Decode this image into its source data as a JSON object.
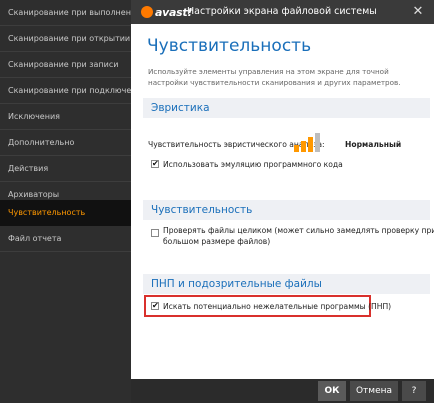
{
  "window": {
    "title": "Настройки экрана файловой системы",
    "logo_text": "avast!"
  },
  "sidebar": {
    "items": [
      {
        "label": "Сканирование при выполнении"
      },
      {
        "label": "Сканирование при открытии"
      },
      {
        "label": "Сканирование при записи"
      },
      {
        "label": "Сканирование при подключении"
      },
      {
        "label": "Исключения"
      },
      {
        "label": "Дополнительно"
      },
      {
        "label": "Действия"
      },
      {
        "label": "Архиваторы"
      },
      {
        "label": "Чувствительность",
        "active": true
      },
      {
        "label": "Файл отчета"
      }
    ]
  },
  "main": {
    "title": "Чувствительность",
    "description": "Используйте элементы управления на этом экране для точной настройки чувствительности сканирования и других параметров.",
    "heuristics": {
      "header": "Эвристика",
      "sensitivity_label": "Чувствительность эвристического анализа:",
      "sensitivity_value": "Нормальный",
      "sensitivity_level": 3,
      "sensitivity_max": 4,
      "emulation_label": "Использовать эмуляцию программного кода",
      "emulation_checked": true
    },
    "sensitivity": {
      "header": "Чувствительность",
      "whole_files_label": "Проверять файлы целиком (может сильно замедлять проверку при большом размере файлов)",
      "whole_files_line1": "Проверять файлы целиком (может сильно замедлять проверку при",
      "whole_files_line2": "большом размере файлов)",
      "whole_files_checked": false
    },
    "pup": {
      "header": "ПНП и подозрительные файлы",
      "scan_pup_label": "Искать потенциально нежелательные программы (ПНП)",
      "scan_pup_checked": true
    }
  },
  "buttons": {
    "ok": "ОК",
    "cancel": "Отмена",
    "help": "?"
  },
  "colors": {
    "accent_orange": "#ff9800",
    "title_blue": "#1a6fba",
    "highlight_red": "#d9302c"
  }
}
